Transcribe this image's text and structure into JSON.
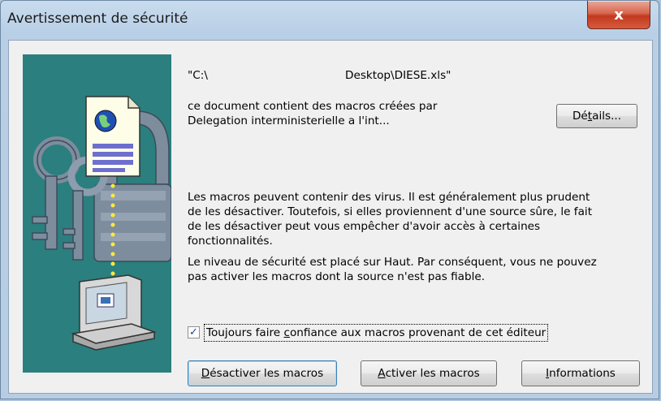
{
  "window": {
    "title": "Avertissement de sécurité",
    "close_glyph": "x"
  },
  "file": {
    "path_start": "\"C:\\",
    "path_end": "Desktop\\DIESE.xls\""
  },
  "message": {
    "line1": "ce document contient des macros créées par",
    "line2": "Delegation interministerielle a l'int...",
    "warning_lines": [
      "Les macros peuvent contenir des virus. Il est généralement plus prudent",
      "de les désactiver. Toutefois, si elles proviennent d'une source sûre, le fait",
      "de les désactiver peut vous empêcher d'avoir accès à certaines",
      "fonctionnalités."
    ],
    "level_lines": [
      "Le niveau de sécurité est placé sur Haut. Par conséquent, vous ne pouvez",
      "pas activer les macros dont la source n'est pas fiable."
    ]
  },
  "checkbox": {
    "checked": true,
    "label_pre": "Toujours faire ",
    "label_accel": "c",
    "label_post": "onfiance aux macros provenant de cet éditeur",
    "check_glyph": "✓"
  },
  "buttons": {
    "details": {
      "pre": "Dé",
      "accel": "t",
      "post": "ails..."
    },
    "disable": {
      "accel": "D",
      "post": "ésactiver les macros"
    },
    "enable": {
      "accel": "A",
      "post": "ctiver les macros"
    },
    "info": {
      "accel": "I",
      "post": "nformations"
    }
  },
  "icons": {
    "illustration": "security-lock-computer-illustration",
    "close": "close-icon"
  },
  "colors": {
    "illustration_bg": "#2b7f7e",
    "close_red": "#c2391e",
    "title_bar": "#b8cfe6"
  }
}
